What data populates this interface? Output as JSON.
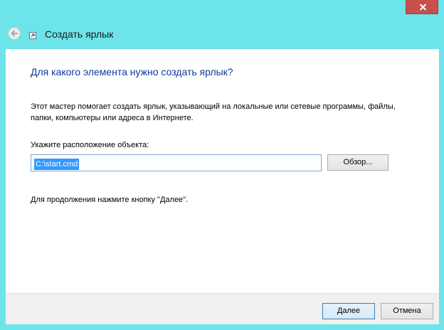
{
  "window": {
    "title": "Создать ярлык"
  },
  "content": {
    "heading": "Для какого элемента нужно создать ярлык?",
    "description": "Этот мастер помогает создать ярлык, указывающий на локальные или сетевые программы, файлы, папки, компьютеры или адреса в Интернете.",
    "location_label": "Укажите расположение объекта:",
    "location_value": "C:\\start.cmd",
    "browse_label": "Обзор...",
    "continue_hint": "Для продолжения нажмите кнопку \"Далее\"."
  },
  "footer": {
    "next_label": "Далее",
    "cancel_label": "Отмена"
  },
  "colors": {
    "window_chrome": "#6de4ea",
    "heading": "#0c3a9b",
    "close_button": "#c7504a",
    "selection": "#3399ff"
  },
  "icons": {
    "back": "back-arrow-icon",
    "shortcut": "shortcut-arrow-icon",
    "close": "close-icon"
  }
}
